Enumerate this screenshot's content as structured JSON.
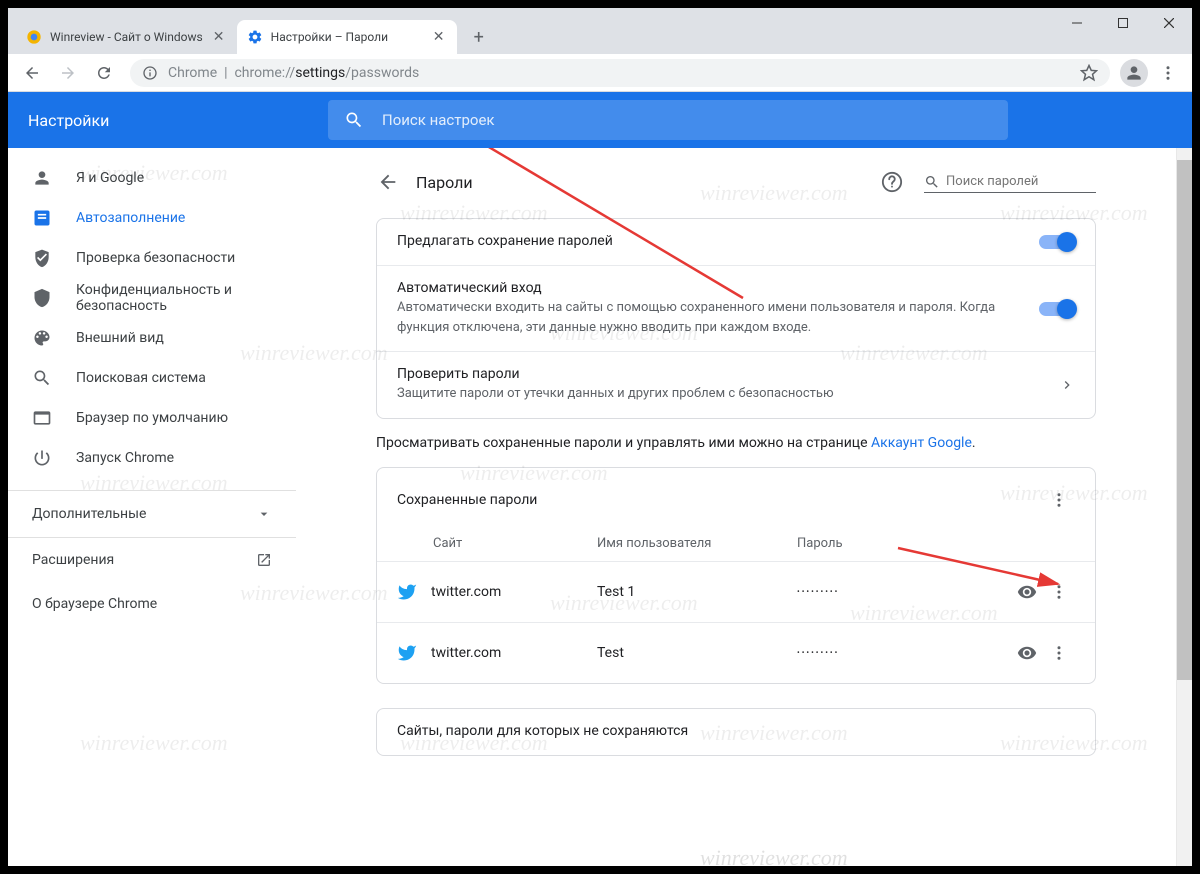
{
  "window": {
    "title_controls": {
      "minimize": "—",
      "maximize": "☐",
      "close": "✕"
    }
  },
  "tabs": [
    {
      "label": "Winreview - Сайт о Windows",
      "active": false
    },
    {
      "label": "Настройки – Пароли",
      "active": true
    }
  ],
  "omnibox": {
    "prefix": "Chrome",
    "separator": "|",
    "url_dim1": "chrome://",
    "url_dark": "settings",
    "url_dim2": "/passwords"
  },
  "header": {
    "title": "Настройки",
    "search_placeholder": "Поиск настроек"
  },
  "sidebar": {
    "items": [
      {
        "label": "Я и Google",
        "icon": "person"
      },
      {
        "label": "Автозаполнение",
        "icon": "autofill",
        "active": true
      },
      {
        "label": "Проверка безопасности",
        "icon": "shield"
      },
      {
        "label": "Конфиденциальность и безопасность",
        "icon": "lock"
      },
      {
        "label": "Внешний вид",
        "icon": "palette"
      },
      {
        "label": "Поисковая система",
        "icon": "search"
      },
      {
        "label": "Браузер по умолчанию",
        "icon": "browser"
      },
      {
        "label": "Запуск Chrome",
        "icon": "power"
      }
    ],
    "advanced": "Дополнительные",
    "extensions": "Расширения",
    "about": "О браузере Chrome"
  },
  "page": {
    "title": "Пароли",
    "search_placeholder": "Поиск паролей",
    "offer_save": "Предлагать сохранение паролей",
    "auto_signin_title": "Автоматический вход",
    "auto_signin_desc": "Автоматически входить на сайты с помощью сохраненного имени пользователя и пароля. Когда функция отключена, эти данные нужно вводить при каждом входе.",
    "check_title": "Проверить пароли",
    "check_desc": "Защитите пароли от утечки данных и других проблем с безопасностью",
    "view_note_prefix": "Просматривать сохраненные пароли и управлять ими можно на странице ",
    "view_note_link": "Аккаунт Google",
    "saved_title": "Сохраненные пароли",
    "col_site": "Сайт",
    "col_user": "Имя пользователя",
    "col_pass": "Пароль",
    "rows": [
      {
        "site": "twitter.com",
        "user": "Test 1",
        "pass": "•••••••••"
      },
      {
        "site": "twitter.com",
        "user": "Test",
        "pass": "•••••••••"
      }
    ],
    "never_title": "Сайты, пароли для которых не сохраняются"
  },
  "watermark": "winreviewer.com"
}
